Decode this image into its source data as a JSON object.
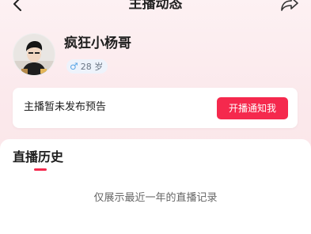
{
  "header": {
    "title": "主播动态",
    "back_icon": "chevron-left-icon",
    "share_icon": "share-icon"
  },
  "profile": {
    "name": "疯狂小杨哥",
    "gender_symbol": "♂",
    "age": "28 岁"
  },
  "notice": {
    "text": "主播暂未发布预告",
    "button_label": "开播通知我"
  },
  "history": {
    "title": "直播历史",
    "empty_text": "仅展示最近一年的直播记录"
  },
  "colors": {
    "accent": "#f5294d",
    "male": "#5aa6e6"
  }
}
